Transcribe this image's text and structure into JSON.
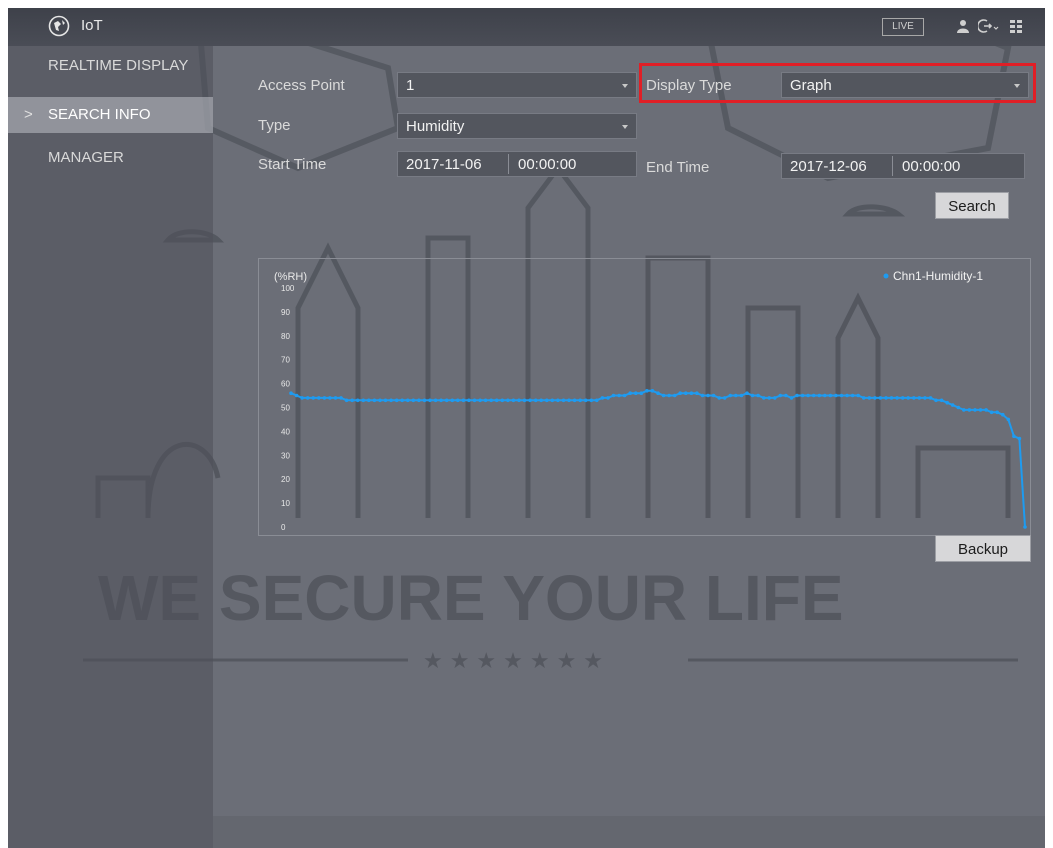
{
  "app": {
    "title": "IoT",
    "live_label": "LIVE"
  },
  "sidebar": {
    "items": [
      {
        "label": "REALTIME DISPLAY",
        "active": false
      },
      {
        "label": "SEARCH INFO",
        "active": true
      },
      {
        "label": "MANAGER",
        "active": false
      }
    ],
    "active_marker": ">"
  },
  "form": {
    "access_point_label": "Access Point",
    "access_point_value": "1",
    "type_label": "Type",
    "type_value": "Humidity",
    "display_type_label": "Display Type",
    "display_type_value": "Graph",
    "start_time_label": "Start Time",
    "start_date": "2017-11-06",
    "start_clock": "00:00:00",
    "end_time_label": "End Time",
    "end_date": "2017-12-06",
    "end_clock": "00:00:00",
    "search_button": "Search",
    "backup_button": "Backup"
  },
  "watermark": {
    "slogan": "WE SECURE YOUR LIFE",
    "stars": "★ ★ ★ ★ ★ ★ ★"
  },
  "colors": {
    "highlight": "#e01f26",
    "series": "#1e9bf0"
  },
  "icons": [
    "iot-globe-icon",
    "user-icon",
    "logout-icon",
    "menu-grid-icon",
    "dropdown-caret-icon"
  ],
  "chart_data": {
    "type": "line",
    "ylabel": "(%RH)",
    "ylim": [
      0,
      100
    ],
    "yticks": [
      0,
      10,
      20,
      30,
      40,
      50,
      60,
      70,
      80,
      90,
      100
    ],
    "grid": false,
    "legend": "top-right",
    "series": [
      {
        "name": "Chn1-Humidity-1",
        "values": [
          56,
          55,
          54,
          54,
          54,
          54,
          54,
          54,
          54,
          54,
          53,
          53,
          53,
          53,
          53,
          53,
          53,
          53,
          53,
          53,
          53,
          53,
          53,
          53,
          53,
          53,
          53,
          53,
          53,
          53,
          53,
          53,
          53,
          53,
          53,
          53,
          53,
          53,
          53,
          53,
          53,
          53,
          53,
          53,
          53,
          53,
          53,
          53,
          53,
          53,
          53,
          53,
          53,
          53,
          53,
          53,
          54,
          54,
          55,
          55,
          55,
          56,
          56,
          56,
          57,
          57,
          56,
          55,
          55,
          55,
          56,
          56,
          56,
          56,
          55,
          55,
          55,
          54,
          54,
          55,
          55,
          55,
          56,
          55,
          55,
          54,
          54,
          54,
          55,
          55,
          54,
          55,
          55,
          55,
          55,
          55,
          55,
          55,
          55,
          55,
          55,
          55,
          55,
          54,
          54,
          54,
          54,
          54,
          54,
          54,
          54,
          54,
          54,
          54,
          54,
          54,
          53,
          53,
          52,
          51,
          50,
          49,
          49,
          49,
          49,
          49,
          48,
          48,
          47,
          45,
          38,
          37,
          0
        ]
      }
    ]
  }
}
